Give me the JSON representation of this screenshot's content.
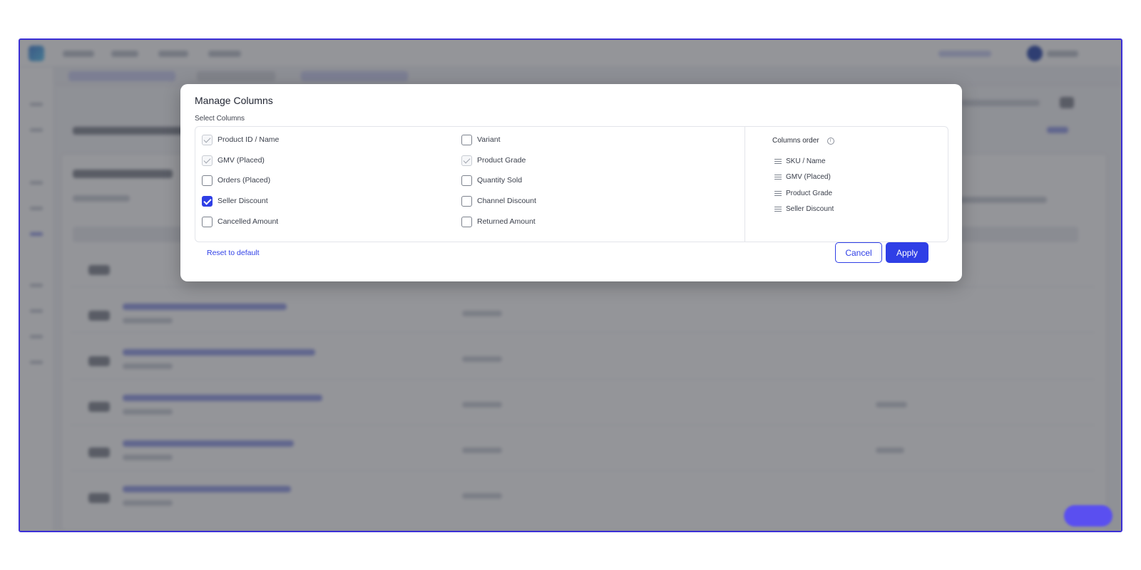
{
  "modal": {
    "title": "Manage Columns",
    "subtitle": "Select Columns",
    "options": [
      {
        "label": "Product ID / Name",
        "state": "locked"
      },
      {
        "label": "Variant",
        "state": "unchecked"
      },
      {
        "label": "GMV (Placed)",
        "state": "locked"
      },
      {
        "label": "Product Grade",
        "state": "locked"
      },
      {
        "label": "Orders (Placed)",
        "state": "unchecked"
      },
      {
        "label": "Quantity Sold",
        "state": "unchecked"
      },
      {
        "label": "Seller Discount",
        "state": "checked"
      },
      {
        "label": "Channel Discount",
        "state": "unchecked"
      },
      {
        "label": "Cancelled Amount",
        "state": "unchecked"
      },
      {
        "label": "Returned Amount",
        "state": "unchecked"
      }
    ],
    "order": {
      "title": "Columns order",
      "info_icon": "info-icon",
      "items": [
        "SKU / Name",
        "GMV (Placed)",
        "Product Grade",
        "Seller Discount"
      ]
    },
    "reset_label": "Reset to default",
    "cancel_label": "Cancel",
    "apply_label": "Apply"
  },
  "colors": {
    "accent": "#2f3fe6",
    "frame": "#3b2fd6",
    "overlay": "rgba(60,62,70,0.55)"
  }
}
